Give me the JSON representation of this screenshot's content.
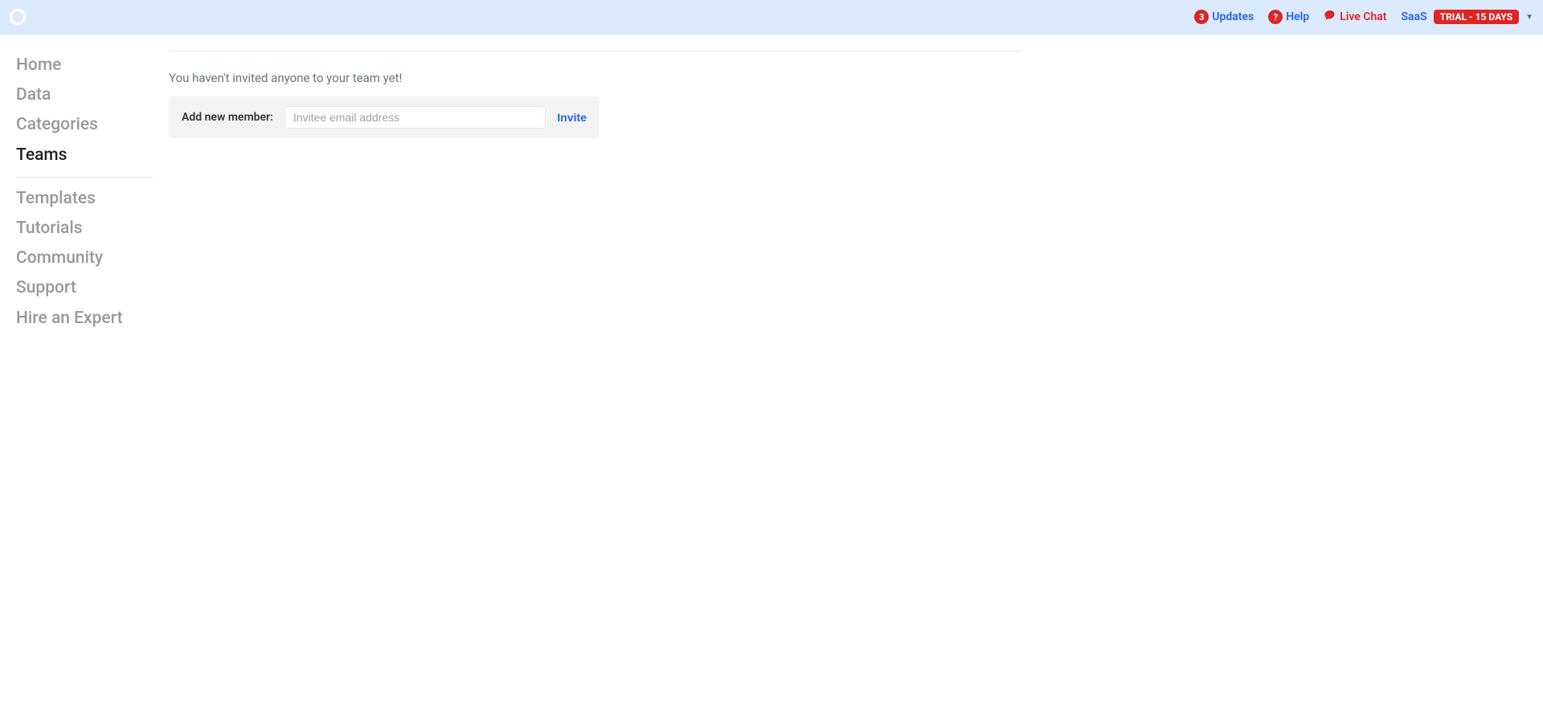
{
  "topbar": {
    "updates": {
      "count": "3",
      "label": "Updates"
    },
    "help": {
      "label": "Help"
    },
    "live_chat": {
      "label": "Live Chat"
    },
    "account": {
      "plan": "SaaS",
      "trial": "TRIAL - 15 DAYS"
    }
  },
  "sidebar": {
    "items_top": [
      {
        "label": "Home"
      },
      {
        "label": "Data"
      },
      {
        "label": "Categories"
      },
      {
        "label": "Teams",
        "active": true
      }
    ],
    "items_bottom": [
      {
        "label": "Templates"
      },
      {
        "label": "Tutorials"
      },
      {
        "label": "Community"
      },
      {
        "label": "Support"
      },
      {
        "label": "Hire an Expert"
      }
    ]
  },
  "main": {
    "empty_message": "You haven't invited anyone to your team yet!",
    "invite": {
      "label": "Add new member:",
      "placeholder": "Invitee email address",
      "button": "Invite"
    }
  }
}
